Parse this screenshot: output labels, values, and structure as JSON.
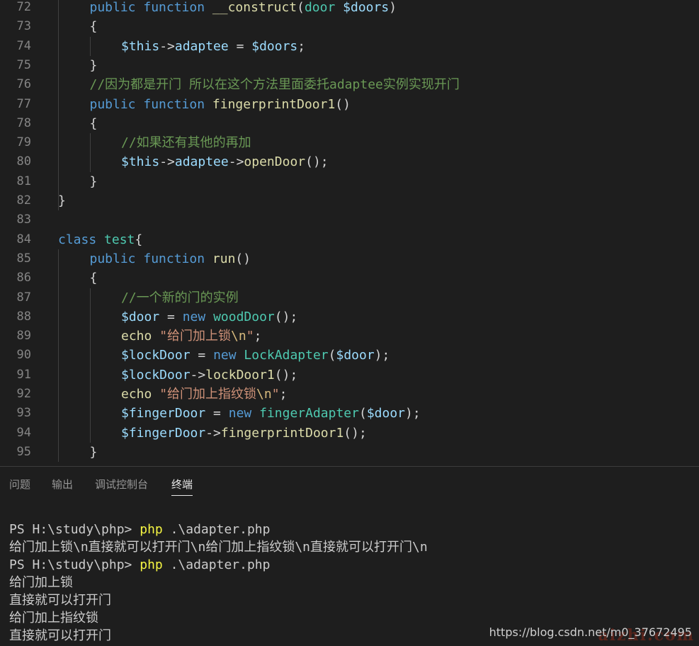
{
  "editor": {
    "lines": [
      {
        "num": "72",
        "indent": 1,
        "tokens": [
          [
            "k1",
            "public "
          ],
          [
            "k1",
            "function "
          ],
          [
            "k2",
            "__construct"
          ],
          [
            "k7",
            "("
          ],
          [
            "k4",
            "door "
          ],
          [
            "k3",
            "$doors"
          ],
          [
            "k7",
            ")"
          ]
        ]
      },
      {
        "num": "73",
        "indent": 1,
        "tokens": [
          [
            "k7",
            "{"
          ]
        ]
      },
      {
        "num": "74",
        "indent": 2,
        "tokens": [
          [
            "k3",
            "$this"
          ],
          [
            "k7",
            "->"
          ],
          [
            "k3",
            "adaptee"
          ],
          [
            "k7",
            " = "
          ],
          [
            "k3",
            "$doors"
          ],
          [
            "k7",
            ";"
          ]
        ]
      },
      {
        "num": "75",
        "indent": 1,
        "tokens": [
          [
            "k7",
            "}"
          ]
        ]
      },
      {
        "num": "76",
        "indent": 1,
        "tokens": [
          [
            "k6",
            "//因为都是开门 所以在这个方法里面委托adaptee实例实现开门"
          ]
        ]
      },
      {
        "num": "77",
        "indent": 1,
        "tokens": [
          [
            "k1",
            "public "
          ],
          [
            "k1",
            "function "
          ],
          [
            "k2",
            "fingerprintDoor1"
          ],
          [
            "k7",
            "()"
          ]
        ]
      },
      {
        "num": "78",
        "indent": 1,
        "tokens": [
          [
            "k7",
            "{"
          ]
        ]
      },
      {
        "num": "79",
        "indent": 2,
        "tokens": [
          [
            "k6",
            "//如果还有其他的再加"
          ]
        ]
      },
      {
        "num": "80",
        "indent": 2,
        "tokens": [
          [
            "k3",
            "$this"
          ],
          [
            "k7",
            "->"
          ],
          [
            "k3",
            "adaptee"
          ],
          [
            "k7",
            "->"
          ],
          [
            "k2",
            "openDoor"
          ],
          [
            "k7",
            "();"
          ]
        ]
      },
      {
        "num": "81",
        "indent": 1,
        "tokens": [
          [
            "k7",
            "}"
          ]
        ]
      },
      {
        "num": "82",
        "indent": 0,
        "tokens": [
          [
            "k7",
            "}"
          ]
        ]
      },
      {
        "num": "83",
        "indent": 0,
        "tokens": []
      },
      {
        "num": "84",
        "indent": 0,
        "tokens": [
          [
            "k1",
            "class "
          ],
          [
            "k4",
            "test"
          ],
          [
            "k7",
            "{"
          ]
        ]
      },
      {
        "num": "85",
        "indent": 1,
        "tokens": [
          [
            "k1",
            "public "
          ],
          [
            "k1",
            "function "
          ],
          [
            "k2",
            "run"
          ],
          [
            "k7",
            "()"
          ]
        ]
      },
      {
        "num": "86",
        "indent": 1,
        "tokens": [
          [
            "k7",
            "{"
          ]
        ]
      },
      {
        "num": "87",
        "indent": 2,
        "tokens": [
          [
            "k6",
            "//一个新的门的实例"
          ]
        ]
      },
      {
        "num": "88",
        "indent": 2,
        "tokens": [
          [
            "k3",
            "$door"
          ],
          [
            "k7",
            " = "
          ],
          [
            "k1",
            "new "
          ],
          [
            "k4",
            "woodDoor"
          ],
          [
            "k7",
            "();"
          ]
        ]
      },
      {
        "num": "89",
        "indent": 2,
        "tokens": [
          [
            "k2",
            "echo "
          ],
          [
            "k5",
            "\"给门加上锁"
          ],
          [
            "k9",
            "\\n"
          ],
          [
            "k5",
            "\""
          ],
          [
            "k7",
            ";"
          ]
        ]
      },
      {
        "num": "90",
        "indent": 2,
        "tokens": [
          [
            "k3",
            "$lockDoor"
          ],
          [
            "k7",
            " = "
          ],
          [
            "k1",
            "new "
          ],
          [
            "k4",
            "LockAdapter"
          ],
          [
            "k7",
            "("
          ],
          [
            "k3",
            "$door"
          ],
          [
            "k7",
            ");"
          ]
        ]
      },
      {
        "num": "91",
        "indent": 2,
        "tokens": [
          [
            "k3",
            "$lockDoor"
          ],
          [
            "k7",
            "->"
          ],
          [
            "k2",
            "lockDoor1"
          ],
          [
            "k7",
            "();"
          ]
        ]
      },
      {
        "num": "92",
        "indent": 2,
        "tokens": [
          [
            "k2",
            "echo "
          ],
          [
            "k5",
            "\"给门加上指纹锁"
          ],
          [
            "k9",
            "\\n"
          ],
          [
            "k5",
            "\""
          ],
          [
            "k7",
            ";"
          ]
        ]
      },
      {
        "num": "93",
        "indent": 2,
        "tokens": [
          [
            "k3",
            "$fingerDoor"
          ],
          [
            "k7",
            " = "
          ],
          [
            "k1",
            "new "
          ],
          [
            "k4",
            "fingerAdapter"
          ],
          [
            "k7",
            "("
          ],
          [
            "k3",
            "$door"
          ],
          [
            "k7",
            ");"
          ]
        ]
      },
      {
        "num": "94",
        "indent": 2,
        "tokens": [
          [
            "k3",
            "$fingerDoor"
          ],
          [
            "k7",
            "->"
          ],
          [
            "k2",
            "fingerprintDoor1"
          ],
          [
            "k7",
            "();"
          ]
        ]
      },
      {
        "num": "95",
        "indent": 1,
        "tokens": [
          [
            "k7",
            "}"
          ]
        ]
      }
    ]
  },
  "panel": {
    "tabs": [
      {
        "label": "问题",
        "active": false
      },
      {
        "label": "输出",
        "active": false
      },
      {
        "label": "调试控制台",
        "active": false
      },
      {
        "label": "终端",
        "active": true
      }
    ]
  },
  "terminal": {
    "lines": [
      {
        "prompt": "PS H:\\study\\php> ",
        "cmd": "php",
        "rest": " .\\adapter.php"
      },
      {
        "text": "给门加上锁\\n直接就可以打开门\\n给门加上指纹锁\\n直接就可以打开门\\n"
      },
      {
        "prompt": "PS H:\\study\\php> ",
        "cmd": "php",
        "rest": " .\\adapter.php"
      },
      {
        "text": "给门加上锁"
      },
      {
        "text": "直接就可以打开门"
      },
      {
        "text": "给门加上指纹锁"
      },
      {
        "text": "直接就可以打开门"
      }
    ]
  },
  "watermark": {
    "url": "https://blog.csdn.net/m0_37672495",
    "mark": "aizhi.com"
  }
}
